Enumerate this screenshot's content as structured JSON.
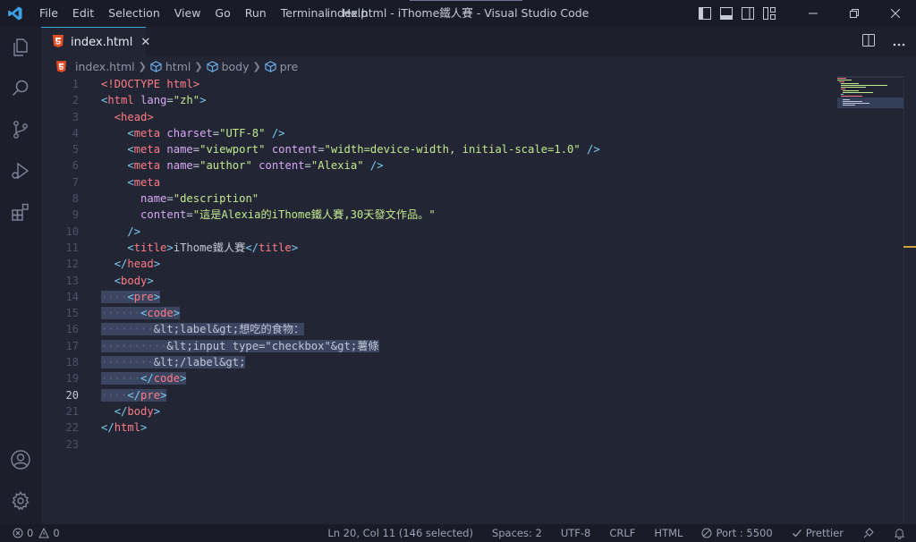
{
  "window": {
    "title": "index.html - iThome鐵人賽 - Visual Studio Code"
  },
  "menu": [
    "File",
    "Edit",
    "Selection",
    "View",
    "Go",
    "Run",
    "Terminal",
    "Help"
  ],
  "tab": {
    "label": "index.html",
    "close": "✕"
  },
  "breadcrumb": [
    "index.html",
    "html",
    "body",
    "pre"
  ],
  "colors": {
    "accent": "#3fa4d8",
    "html_icon": "#e44d26",
    "selection": "#3b4560",
    "tag": "#ff7b86",
    "attr": "#d8a8f5",
    "string": "#c4e88d",
    "punct": "#7ecbf0"
  },
  "editor": {
    "active_line": 20,
    "line_numbers": [
      "1",
      "2",
      "3",
      "4",
      "5",
      "6",
      "7",
      "8",
      "9",
      "10",
      "11",
      "12",
      "13",
      "14",
      "15",
      "16",
      "17",
      "18",
      "19",
      "20",
      "21",
      "22",
      "23"
    ],
    "tokens": {
      "doctype": "<!DOCTYPE html>",
      "l2_open": "<",
      "l2_tag": "html",
      "l2_attr": "lang",
      "l2_eq": "=",
      "l2_val": "\"zh\"",
      "l2_close": ">",
      "head_open": "<head>",
      "meta1_tag": "meta",
      "meta1_attr": "charset",
      "meta1_val": "\"UTF-8\"",
      "meta1_end": " />",
      "meta2_attr1": "name",
      "meta2_val1": "\"viewport\"",
      "meta2_attr2": "content",
      "meta2_val2": "\"width=device-width, initial-scale=1.0\"",
      "meta3_attr1": "name",
      "meta3_val1": "\"author\"",
      "meta3_attr2": "content",
      "meta3_val2": "\"Alexia\"",
      "meta4_tag": "meta",
      "l8_attr": "name",
      "l8_val": "\"description\"",
      "l9_attr": "content",
      "l9_val": "\"這是Alexia的iThome鐵人賽,30天發文作品。\"",
      "l10": "/>",
      "title_tag": "title",
      "title_text": "iThome鐵人賽",
      "head_close": "head",
      "body_open": "body",
      "pre_open": "pre",
      "code_open": "code",
      "l16_text": "&lt;label&gt;想吃的食物：",
      "l17_text": "&lt;input type=\"checkbox\"&gt;薯條",
      "l18_text": "&lt;/label&gt;",
      "code_close": "code",
      "pre_close": "pre",
      "body_close": "body",
      "html_close": "html"
    }
  },
  "statusbar": {
    "problems": "0",
    "warnings": "0",
    "position": "Ln 20, Col 11 (146 selected)",
    "spaces": "Spaces: 2",
    "encoding": "UTF-8",
    "eol": "CRLF",
    "language": "HTML",
    "port": "Port : 5500",
    "prettier": "Prettier"
  }
}
